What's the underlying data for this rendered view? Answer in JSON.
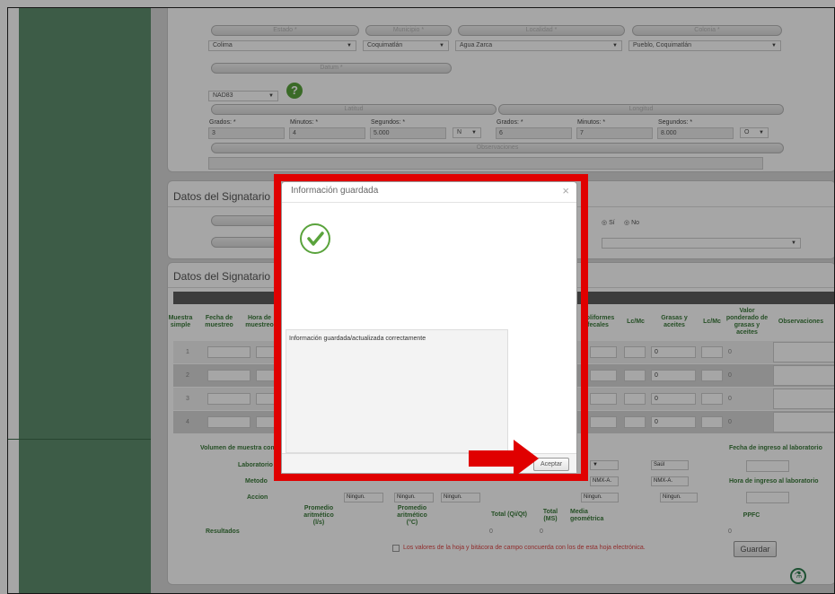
{
  "location": {
    "labels": {
      "estado": "Estado *",
      "municipio": "Municipio *",
      "localidad": "Localidad *",
      "colonia": "Colonia *",
      "datum": "Datum *",
      "latitud": "Latitud",
      "longitud": "Longitud",
      "observaciones": "Observaciones"
    },
    "values": {
      "estado": "Colima",
      "municipio": "Coquimatlán",
      "localidad": "Agua Zarca",
      "colonia": "Pueblo, Coquimatlán",
      "datum": "NAD83"
    },
    "lat": {
      "grados_label": "Grados: *",
      "minutos_label": "Minutos: *",
      "segundos_label": "Segundos: *",
      "grados": "3",
      "minutos": "4",
      "segundos": "5.000",
      "dir": "N"
    },
    "lon": {
      "grados_label": "Grados: *",
      "minutos_label": "Minutos: *",
      "segundos_label": "Segundos: *",
      "grados": "6",
      "minutos": "7",
      "segundos": "8.000",
      "dir": "O"
    }
  },
  "signatario1": {
    "title": "Datos del Signatario",
    "si": "Sí",
    "no": "No"
  },
  "signatario2": {
    "title": "Datos del Signatario",
    "headers": {
      "muestra": "Muestra simple",
      "fecha": "Fecha de muestreo",
      "hora": "Hora de muestreo",
      "coliformes": "Coliformes fecales",
      "lcmc1": "Lc/Mc",
      "grasas": "Grasas y aceites",
      "lcmc2": "Lc/Mc",
      "valor": "Valor ponderado de grasas y aceites",
      "obs": "Observaciones"
    },
    "rows": [
      {
        "n": "1",
        "grasas": "0",
        "valor": "0"
      },
      {
        "n": "2",
        "grasas": "0",
        "valor": "0"
      },
      {
        "n": "3",
        "grasas": "0",
        "valor": "0"
      },
      {
        "n": "4",
        "grasas": "0",
        "valor": "0"
      }
    ],
    "volumen": "Volumen de muestra compuesta",
    "fecha_ingreso": "Fecha de ingreso al laboratorio",
    "laboratorio": "Laboratorio",
    "metodo": "Metodo",
    "accion": "Accion",
    "hora_ingreso": "Hora de ingreso al laboratorio",
    "lab_values": [
      "Saúl"
    ],
    "metodo_values": [
      "NMX-A.",
      "NMX-A."
    ],
    "accion_values": [
      "Ningun.",
      "Ningun.",
      "Ningun.",
      "Ningun.",
      "Ningun."
    ],
    "resultados": "Resultados",
    "prom_ls": "Promedio aritmético (l/s)",
    "prom_c": "Promedio aritmético (°C)",
    "total_qi": "Total (Qi/Qt)",
    "total_ms": "Total (MS)",
    "media": "Media geométrica",
    "ppfc": "PPFC",
    "zero": "0",
    "consent": "Los valores de la hoja y bitácora de campo concuerda con los de esta hoja electrónica.",
    "guardar": "Guardar"
  },
  "modal": {
    "title": "Información guardada",
    "message": "Información guardada/actualizada correctamente",
    "accept": "Aceptar",
    "close": "×"
  }
}
